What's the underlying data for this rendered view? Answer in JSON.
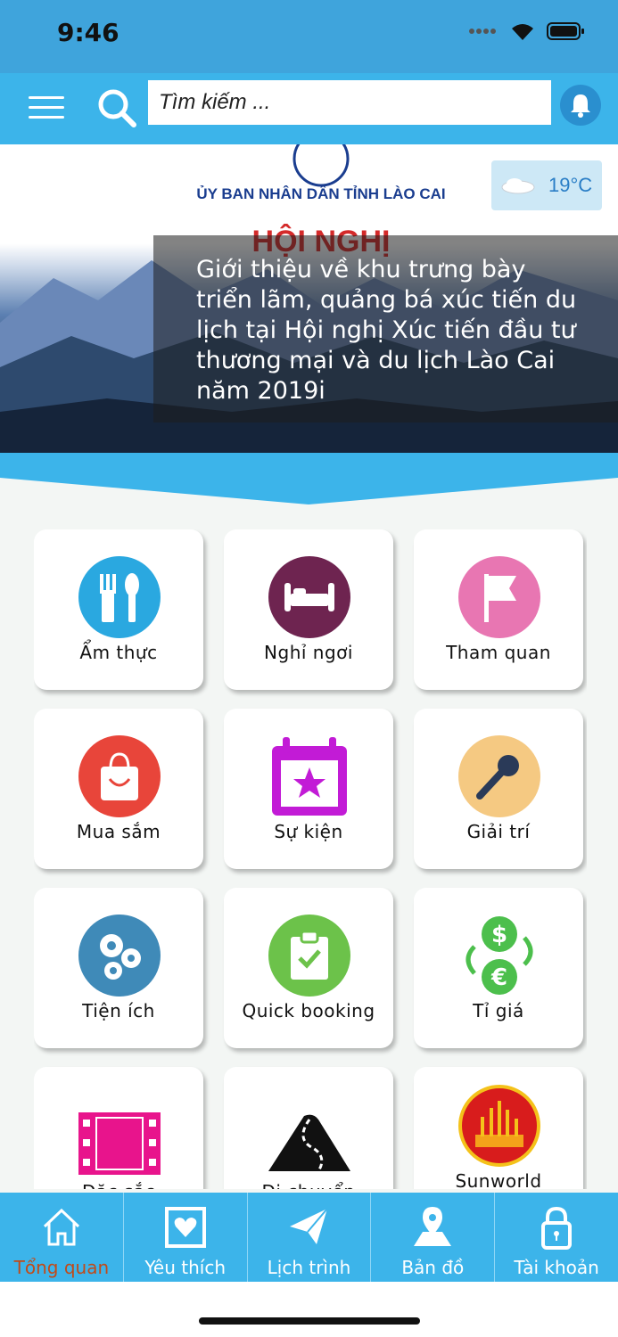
{
  "status": {
    "time": "9:46"
  },
  "search": {
    "placeholder": "Tìm kiếm ..."
  },
  "banner": {
    "org": "ỦY BAN NHÂN DÂN TỈNH LÀO CAI",
    "headline": "HỘI NGHỊ",
    "caption": "Giới thiệu về khu trưng bày triển lãm, quảng bá xúc tiến du lịch tại Hội nghị Xúc tiến đầu tư thương mại và du lịch Lào Cai năm 2019i",
    "weather": {
      "temp": "19°C",
      "icon": "cloud-icon"
    }
  },
  "grid": [
    {
      "label": "Ẩm thực",
      "icon": "fork-knife-icon",
      "color": "#2aa8e0"
    },
    {
      "label": "Nghỉ ngơi",
      "icon": "bed-icon",
      "color": "#6e2450"
    },
    {
      "label": "Tham quan",
      "icon": "flag-icon",
      "color": "#e876b2"
    },
    {
      "label": "Mua sắm",
      "icon": "shopping-bag-icon",
      "color": "#e8453a"
    },
    {
      "label": "Sự kiện",
      "icon": "calendar-star-icon",
      "color": "#c21bd6"
    },
    {
      "label": "Giải trí",
      "icon": "microphone-icon",
      "color": "#f5c982"
    },
    {
      "label": "Tiện ích",
      "icon": "gears-icon",
      "color": "#3f8ab8"
    },
    {
      "label": "Quick booking",
      "icon": "clipboard-check-icon",
      "color": "#6cc24a"
    },
    {
      "label": "Tỉ giá",
      "icon": "currency-exchange-icon",
      "color": "#4cbf4c"
    },
    {
      "label": "Đặc sắc",
      "icon": "film-icon",
      "color": "#e8148c"
    },
    {
      "label": "Di chuyển",
      "icon": "road-icon",
      "color": "#111111"
    },
    {
      "label": "Sunworld",
      "icon": "sunworld-logo-icon",
      "color": "#d81c1c"
    }
  ],
  "tabs": [
    {
      "label": "Tổng quan",
      "icon": "home-icon",
      "active": true
    },
    {
      "label": "Yêu thích",
      "icon": "heart-icon",
      "active": false
    },
    {
      "label": "Lịch trình",
      "icon": "paper-plane-icon",
      "active": false
    },
    {
      "label": "Bản đồ",
      "icon": "map-pin-icon",
      "active": false
    },
    {
      "label": "Tài khoản",
      "icon": "lock-icon",
      "active": false
    }
  ]
}
